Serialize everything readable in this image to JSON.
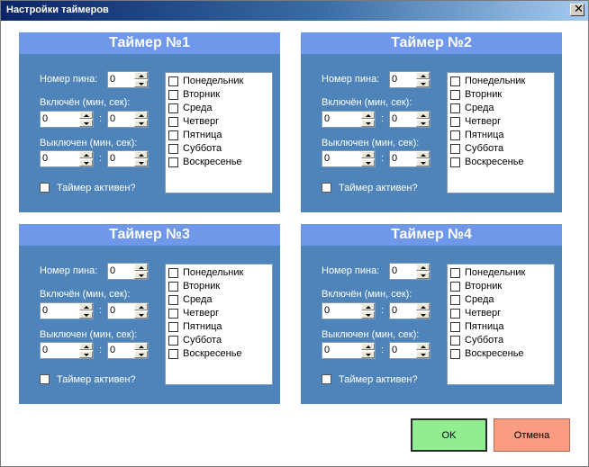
{
  "window": {
    "title": "Настройки таймеров",
    "close_glyph": "✕"
  },
  "labels": {
    "pin": "Номер пина:",
    "on": "Включён (мин, сек):",
    "off": "Выключен (мин, сек):",
    "active": "Таймер активен?",
    "colon": ":"
  },
  "days": [
    "Понедельник",
    "Вторник",
    "Среда",
    "Четверг",
    "Пятница",
    "Суббота",
    "Воскресенье"
  ],
  "timers": [
    {
      "title": "Таймер №1",
      "pin": "0",
      "on_min": "0",
      "on_sec": "0",
      "off_min": "0",
      "off_sec": "0",
      "active": false
    },
    {
      "title": "Таймер №2",
      "pin": "0",
      "on_min": "0",
      "on_sec": "0",
      "off_min": "0",
      "off_sec": "0",
      "active": false
    },
    {
      "title": "Таймер №3",
      "pin": "0",
      "on_min": "0",
      "on_sec": "0",
      "off_min": "0",
      "off_sec": "0",
      "active": false
    },
    {
      "title": "Таймер №4",
      "pin": "0",
      "on_min": "0",
      "on_sec": "0",
      "off_min": "0",
      "off_sec": "0",
      "active": false
    }
  ],
  "buttons": {
    "ok": "OK",
    "cancel": "Отмена"
  },
  "colors": {
    "panel": "#4e84b9",
    "panel_header": "#6f98ea",
    "ok": "#90ee90",
    "cancel": "#fa9c80"
  }
}
